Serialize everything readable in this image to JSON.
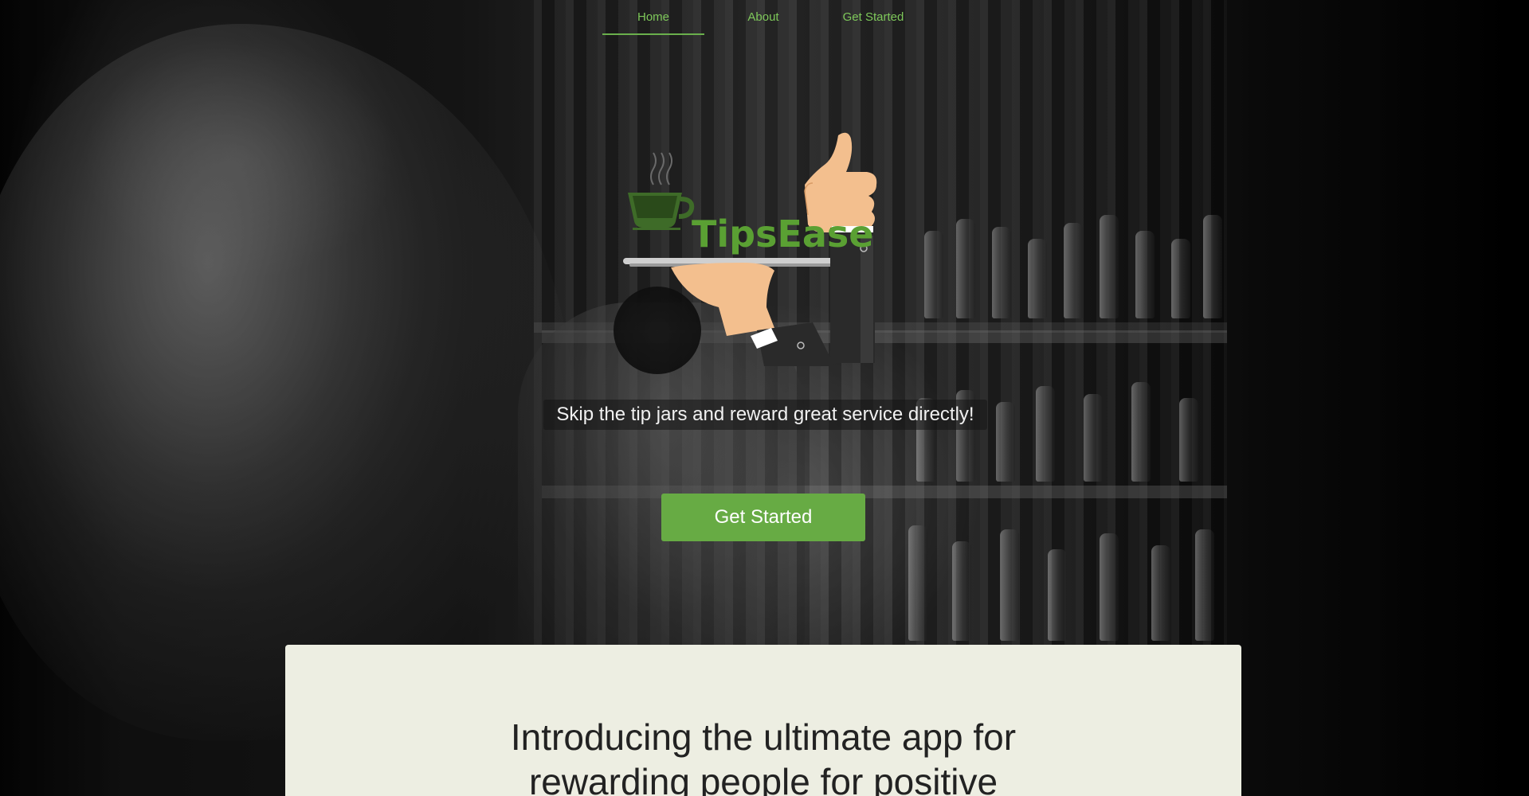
{
  "nav": {
    "items": [
      {
        "label": "Home",
        "active": true
      },
      {
        "label": "About",
        "active": false
      },
      {
        "label": "Get Started",
        "active": false
      }
    ]
  },
  "logo": {
    "text": "TipsEase",
    "icon": "coffee-cup-on-tray-thumbs-up"
  },
  "hero": {
    "tagline": "Skip the tip jars and reward great service directly!",
    "cta_label": "Get Started"
  },
  "intro": {
    "heading_line1": "Introducing the ultimate app for",
    "heading_line2": "rewarding people for positive"
  },
  "colors": {
    "accent": "#67ab44",
    "nav_text": "#7ec85a",
    "card_bg": "#edeee2"
  }
}
